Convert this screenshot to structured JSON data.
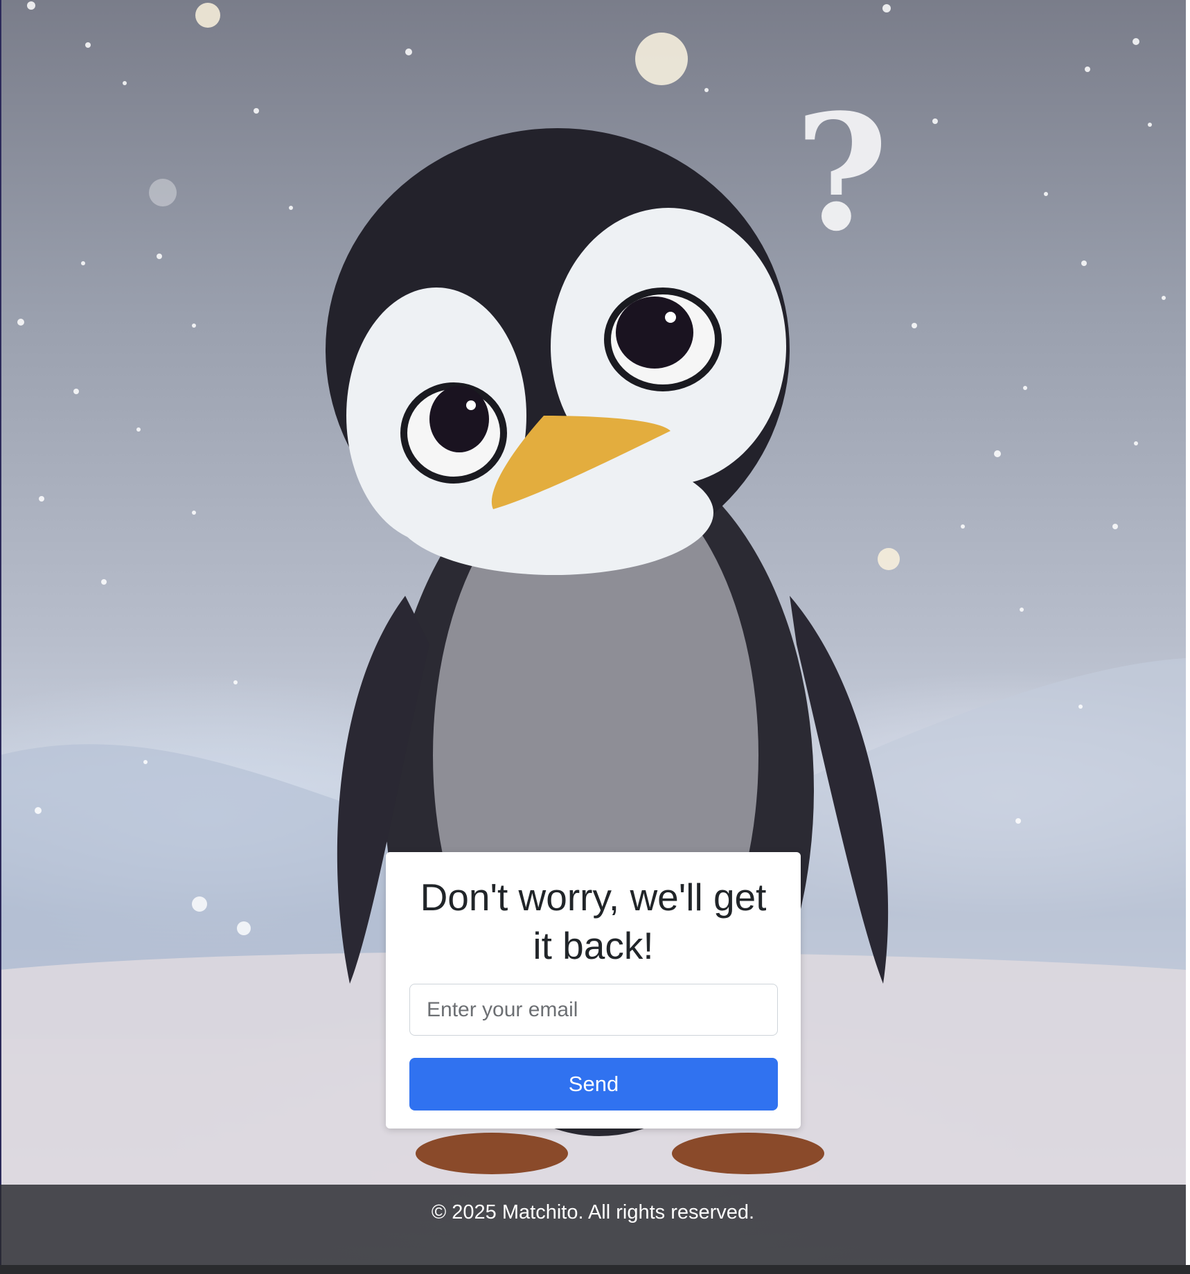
{
  "background": {
    "image_subject": "penguin-in-snow"
  },
  "card": {
    "heading": "Don't worry, we'll get it back!",
    "email_placeholder": "Enter your email",
    "send_label": "Send",
    "accent_color": "#3072f0"
  },
  "footer": {
    "copyright": "© 2025 Matchito. All rights reserved."
  }
}
